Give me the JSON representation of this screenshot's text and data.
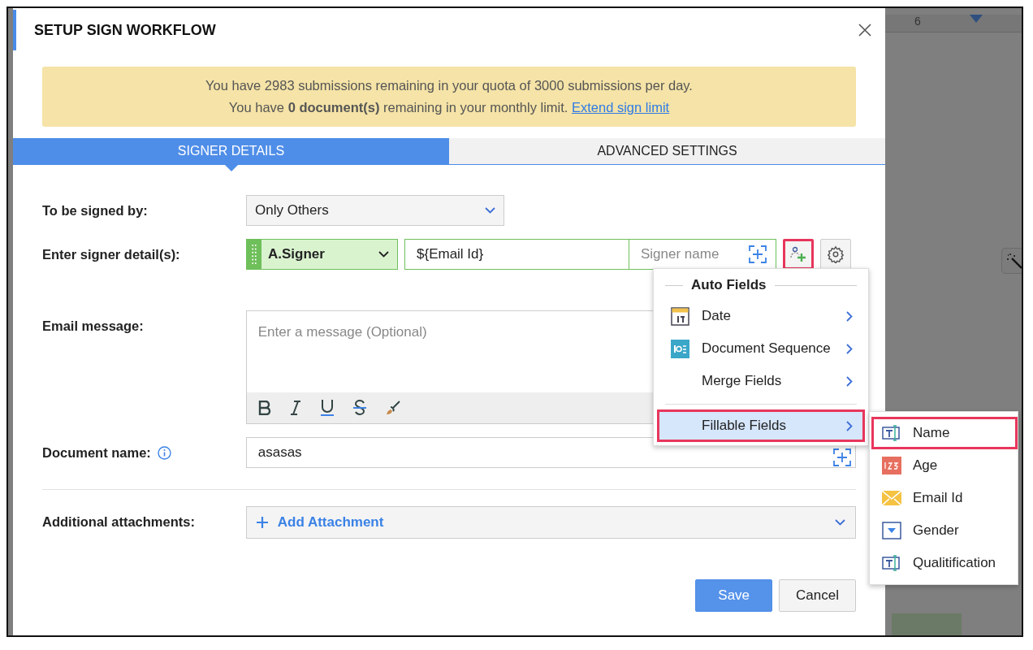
{
  "dialog": {
    "title": "SETUP SIGN WORKFLOW"
  },
  "notice": {
    "line_1": "You have 2983 submissions remaining in your quota of 3000 submissions per day.",
    "line_2": "You have **0 document(s)** remaining in your monthly limit.",
    "link": "Extend sign limit"
  },
  "tabs": [
    {
      "label": "SIGNER DETAILS",
      "selected": true
    },
    {
      "label": "ADVANCED SETTINGS",
      "selected": false
    }
  ],
  "signed_by": {
    "label": "To be signed by:",
    "value": "Only Others"
  },
  "signer": {
    "label": "Enter signer detail(s):",
    "role": "A.Signer",
    "email": "${Email Id}",
    "name_placeholder": "Signer name",
    "add_field_highlighted": true
  },
  "email_message": {
    "label": "Email message:",
    "placeholder": "Enter a message (Optional)"
  },
  "document_name": {
    "label": "Document name:",
    "value": "asasas"
  },
  "attachments": {
    "label": "Additional attachments:",
    "button": "Add Attachment"
  },
  "buttons": [
    {
      "label": "Save",
      "kind": "primary"
    },
    {
      "label": "Cancel",
      "kind": "secondary"
    }
  ],
  "field_menu": {
    "heading": "Auto Fields",
    "items": [
      {
        "label": "Date",
        "kind": "date",
        "selected": false
      },
      {
        "label": "Document Sequence",
        "kind": "sequence",
        "selected": false
      },
      {
        "label": "Merge Fields",
        "kind": "none",
        "selected": false
      },
      {
        "label": "Fillable Fields",
        "kind": "none",
        "selected": true
      }
    ]
  },
  "fillable_menu": {
    "items": [
      {
        "label": "Name",
        "kind": "text",
        "selected": true
      },
      {
        "label": "Age",
        "kind": "number",
        "selected": false
      },
      {
        "label": "Email Id",
        "kind": "email",
        "selected": false
      },
      {
        "label": "Gender",
        "kind": "dropdown",
        "selected": false
      },
      {
        "label": "Qualitification",
        "kind": "text",
        "selected": false
      }
    ]
  },
  "ruler": {
    "label": "6"
  }
}
